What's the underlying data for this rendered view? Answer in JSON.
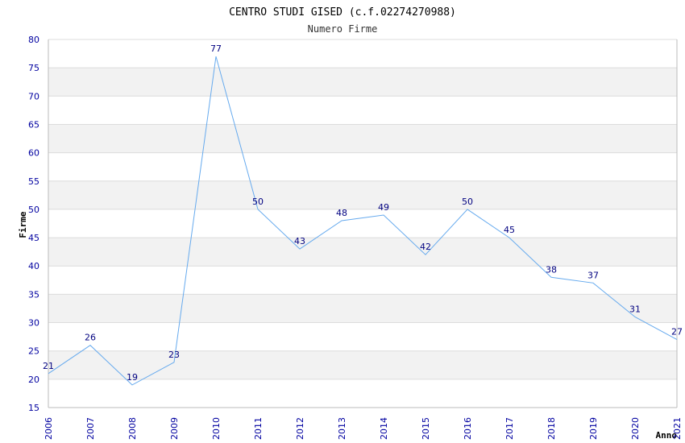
{
  "colors": {
    "band": "#f2f2f2",
    "grid": "#dcdcdc",
    "line": "#66aaee",
    "tick_text": "#0000a0",
    "label_text": "#000080"
  },
  "chart_data": {
    "type": "line",
    "title": "CENTRO STUDI GISED (c.f.02274270988)",
    "subtitle": "Numero Firme",
    "xlabel": "Anno",
    "ylabel": "Firme",
    "x": [
      "2006",
      "2007",
      "2008",
      "2009",
      "2010",
      "2011",
      "2012",
      "2013",
      "2014",
      "2015",
      "2016",
      "2017",
      "2018",
      "2019",
      "2020",
      "2021"
    ],
    "y": [
      21,
      26,
      19,
      23,
      77,
      50,
      43,
      48,
      49,
      42,
      50,
      45,
      38,
      37,
      31,
      27
    ],
    "ylim": [
      15,
      80
    ],
    "ytick_step": 5,
    "grid": true,
    "legend": "none",
    "data_labels": true
  }
}
